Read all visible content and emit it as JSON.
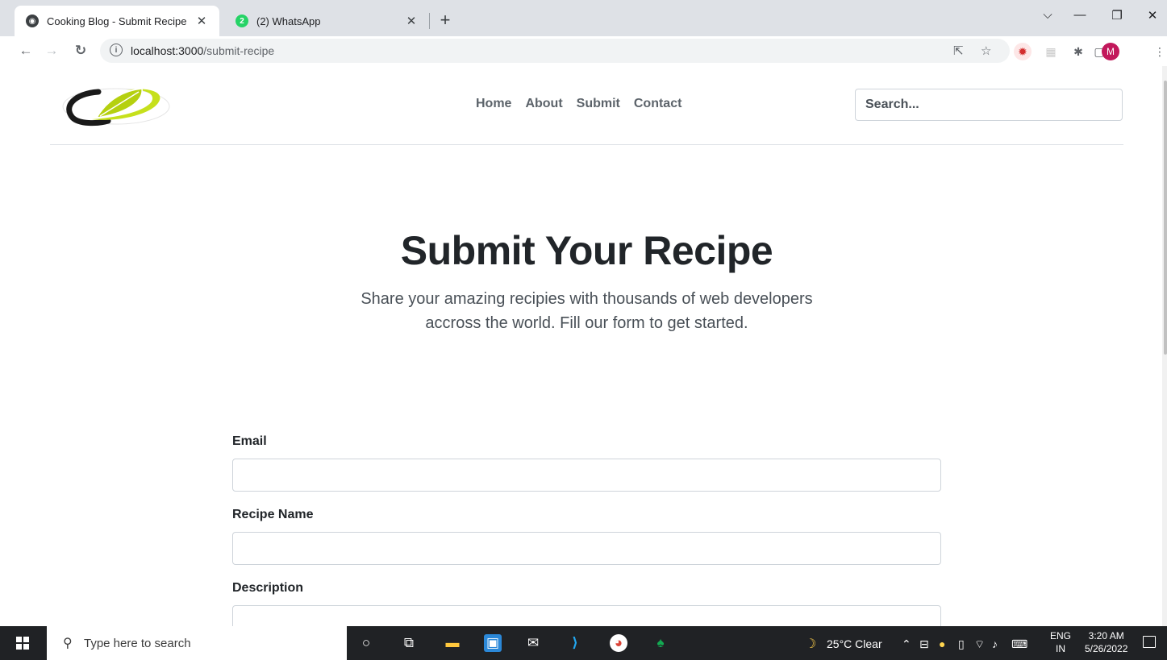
{
  "browser": {
    "tabs": [
      {
        "title": "Cooking Blog - Submit Recipe",
        "active": true,
        "favicon": "globe-icon"
      },
      {
        "title": "(2) WhatsApp",
        "active": false,
        "favicon": "whatsapp-icon",
        "badge": "2"
      }
    ],
    "new_tab_label": "+",
    "url_host": "localhost:3000",
    "url_path": "/submit-recipe",
    "profile_initial": "M"
  },
  "site": {
    "nav": [
      "Home",
      "About",
      "Submit",
      "Contact"
    ],
    "search_placeholder": "Search..."
  },
  "hero": {
    "title": "Submit Your Recipe",
    "subtitle_line1": "Share your amazing recipies with thousands of web developers",
    "subtitle_line2": "accross the world. Fill our form to get started."
  },
  "form": {
    "fields": [
      {
        "label": "Email",
        "value": ""
      },
      {
        "label": "Recipe Name",
        "value": ""
      },
      {
        "label": "Description",
        "value": ""
      }
    ]
  },
  "taskbar": {
    "search_placeholder": "Type here to search",
    "weather": "25°C  Clear",
    "lang_line1": "ENG",
    "lang_line2": "IN",
    "time": "3:20 AM",
    "date": "5/26/2022"
  },
  "colors": {
    "logo_green": "#c6e01c",
    "logo_dark": "#1a1a1a",
    "heading": "#212529",
    "muted": "#495057",
    "nav": "#5c636a"
  }
}
